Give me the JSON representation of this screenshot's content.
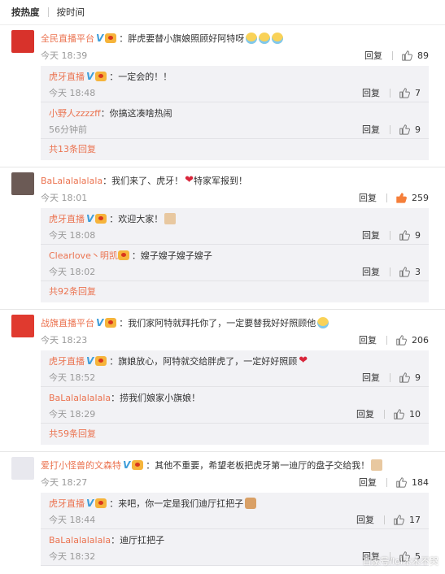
{
  "sort_tabs": [
    "按热度",
    "按时间"
  ],
  "reply_label": "回复",
  "comments": [
    {
      "user": "全民直播平台",
      "text": "：胖虎要替小旗娘照顾好阿特呀",
      "time": "今天 18:39",
      "likes": "89",
      "liked": false,
      "avatar_color": "#d8322b",
      "emoji": [
        "cry",
        "cry",
        "cry"
      ],
      "replies": [
        {
          "user": "虎牙直播",
          "text": "：一定会的！！",
          "time": "今天 18:48",
          "likes": "7",
          "emoji": []
        },
        {
          "user": "小野人zzzzff",
          "text": "：你搞这凑啥热闹",
          "time": "56分钟前",
          "likes": "9",
          "emoji": []
        }
      ],
      "more": "共13条回复"
    },
    {
      "user": "BaLalalalalala",
      "text": "：我们来了、虎牙！",
      "text2": "特家军报到！",
      "time": "今天 18:01",
      "likes": "259",
      "liked": true,
      "avatar_color": "#6b5a55",
      "emoji": [
        "heart"
      ],
      "replies": [
        {
          "user": "虎牙直播",
          "text": "：欢迎大家！",
          "time": "今天 18:08",
          "likes": "9",
          "emoji": [
            "img"
          ]
        },
        {
          "user": "Clearlove丶明凯",
          "text": "：嫂子嫂子嫂子嫂子",
          "time": "今天 18:02",
          "likes": "3",
          "emoji": []
        }
      ],
      "more": "共92条回复"
    },
    {
      "user": "战旗直播平台",
      "text": "：我们家阿特就拜托你了，一定要替我好好照顾他",
      "time": "今天 18:23",
      "likes": "206",
      "liked": false,
      "avatar_color": "#e03a2f",
      "emoji": [
        "cry"
      ],
      "replies": [
        {
          "user": "虎牙直播",
          "text": "：旗娘放心，阿特就交给胖虎了，一定好好照顾",
          "time": "今天 18:52",
          "likes": "9",
          "emoji": [
            "heart"
          ]
        },
        {
          "user": "BaLalalalalala",
          "text": "：捞我们娘家小旗娘！",
          "time": "今天 18:29",
          "likes": "10",
          "emoji": []
        }
      ],
      "more": "共59条回复"
    },
    {
      "user": "爱打小怪兽的文森特",
      "text": "：其他不重要，希望老板把虎牙第一迪厅的盘子交给我！",
      "time": "今天 18:27",
      "likes": "184",
      "liked": false,
      "avatar_color": "#e8e8ee",
      "emoji": [
        "img"
      ],
      "replies": [
        {
          "user": "虎牙直播",
          "text": "：来吧，你一定是我们迪厅扛把子",
          "time": "今天 18:44",
          "likes": "17",
          "emoji": [
            "dog"
          ]
        },
        {
          "user": "BaLalalalalala",
          "text": "：迪厅扛把子",
          "time": "今天 18:32",
          "likes": "5",
          "emoji": []
        }
      ],
      "more": ""
    }
  ],
  "watermark": "百家号/lol木木不哭"
}
